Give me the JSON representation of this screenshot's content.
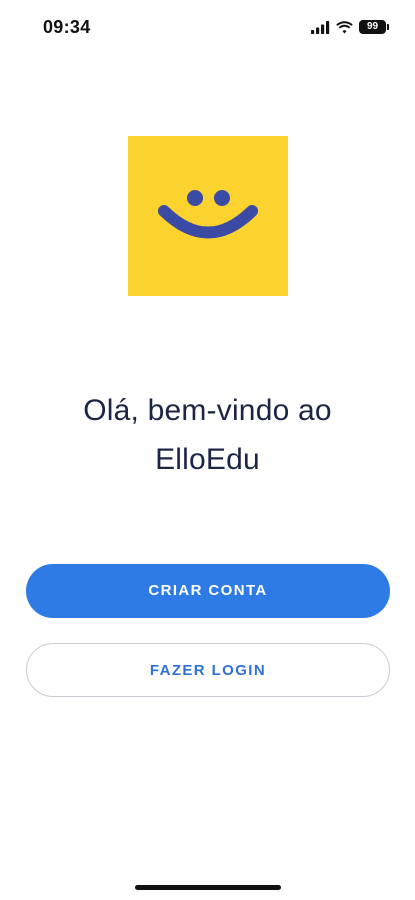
{
  "status_bar": {
    "time": "09:34",
    "battery_level": "99",
    "icons": [
      "signal-icon",
      "wifi-icon",
      "battery-icon"
    ]
  },
  "logo": {
    "icon": "smiley-face-icon",
    "background_color": "#fbd22e",
    "face_color": "#3a4aa5"
  },
  "welcome": {
    "line1": "Olá, bem-vindo ao",
    "line2": "ElloEdu"
  },
  "actions": {
    "create_account_label": "CRIAR CONTA",
    "login_label": "FAZER LOGIN"
  },
  "colors": {
    "primary": "#2f7be6",
    "text": "#1c2545"
  }
}
